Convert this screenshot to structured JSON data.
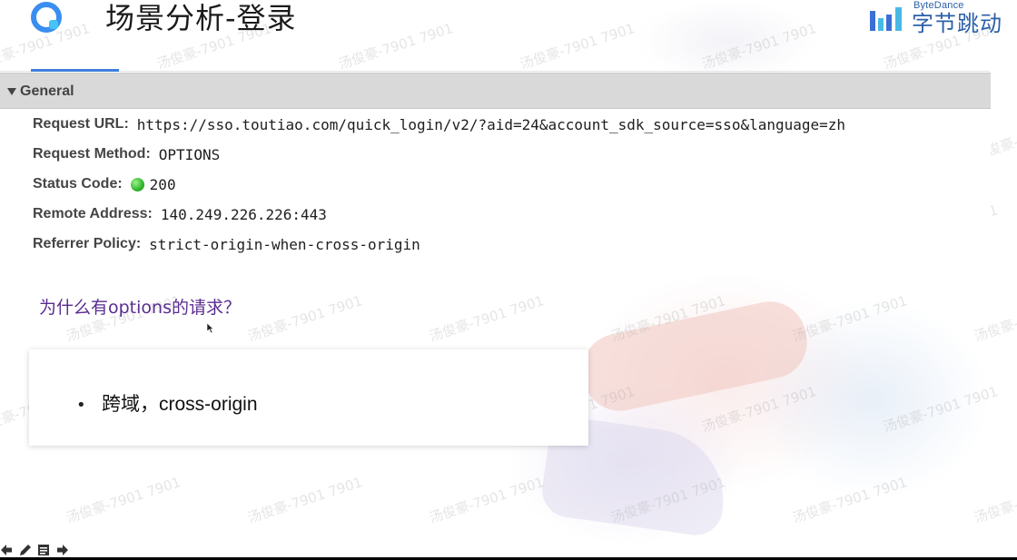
{
  "header": {
    "title": "场景分析-登录",
    "brand_small": "ByteDance",
    "brand_big": "字节跳动"
  },
  "general": {
    "section_label": "General",
    "rows": [
      {
        "key": "Request URL:",
        "value": "https://sso.toutiao.com/quick_login/v2/?aid=24&account_sdk_source=sso&language=zh"
      },
      {
        "key": "Request Method:",
        "value": "OPTIONS"
      },
      {
        "key": "Status Code:",
        "value": "200"
      },
      {
        "key": "Remote Address:",
        "value": "140.249.226.226:443"
      },
      {
        "key": "Referrer Policy:",
        "value": "strict-origin-when-cross-origin"
      }
    ]
  },
  "question": "为什么有options的请求？",
  "answer": {
    "bullet": "•",
    "text": "跨域，cross-origin"
  },
  "watermark": "汤俊豪-7901 7901",
  "colors": {
    "accent": "#3f7fdc",
    "brand": "#2b5fa8",
    "question": "#5a2d91",
    "status_ok": "#2fb52a"
  },
  "icons": {
    "logo": "app-logo-icon",
    "brand": "bytedance-logo-icon",
    "toolbar": [
      "prev-arrow-icon",
      "pen-icon",
      "slides-icon",
      "next-arrow-icon"
    ]
  }
}
